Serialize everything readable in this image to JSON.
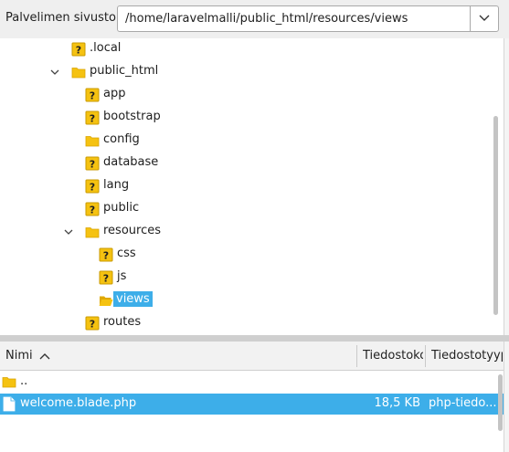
{
  "address_bar": {
    "label": "Palvelimen sivusto:",
    "path": "/home/laravelmalli/public_html/resources/views",
    "dropdown_icon": "chevron-down-icon"
  },
  "tree": {
    "items": [
      {
        "label": ".local",
        "icon": "unknown-folder-icon",
        "expander": "none"
      },
      {
        "label": "public_html",
        "icon": "folder-icon",
        "expander": "expanded"
      },
      {
        "label": "app",
        "icon": "unknown-folder-icon",
        "expander": "none"
      },
      {
        "label": "bootstrap",
        "icon": "unknown-folder-icon",
        "expander": "none"
      },
      {
        "label": "config",
        "icon": "folder-icon",
        "expander": "none"
      },
      {
        "label": "database",
        "icon": "unknown-folder-icon",
        "expander": "none"
      },
      {
        "label": "lang",
        "icon": "unknown-folder-icon",
        "expander": "none"
      },
      {
        "label": "public",
        "icon": "unknown-folder-icon",
        "expander": "none"
      },
      {
        "label": "resources",
        "icon": "folder-icon",
        "expander": "expanded"
      },
      {
        "label": "css",
        "icon": "unknown-folder-icon",
        "expander": "none"
      },
      {
        "label": "js",
        "icon": "unknown-folder-icon",
        "expander": "none"
      },
      {
        "label": "views",
        "icon": "open-folder-icon",
        "expander": "none",
        "selected": true
      },
      {
        "label": "routes",
        "icon": "unknown-folder-icon",
        "expander": "none"
      }
    ]
  },
  "file_list": {
    "columns": [
      {
        "label": "Nimi",
        "sort": "ascending"
      },
      {
        "label": "Tiedostokoko"
      },
      {
        "label": "Tiedostotyyppi"
      }
    ],
    "rows": [
      {
        "name": "..",
        "icon": "folder-icon",
        "size": "",
        "type": ""
      },
      {
        "name": "welcome.blade.php",
        "icon": "file-icon",
        "size": "18,5 KB",
        "type": "php-tiedo...",
        "selected": true
      }
    ]
  },
  "colors": {
    "selection": "#3daee9",
    "folder": "#f5c211",
    "unknown_badge": "#f5c211"
  }
}
